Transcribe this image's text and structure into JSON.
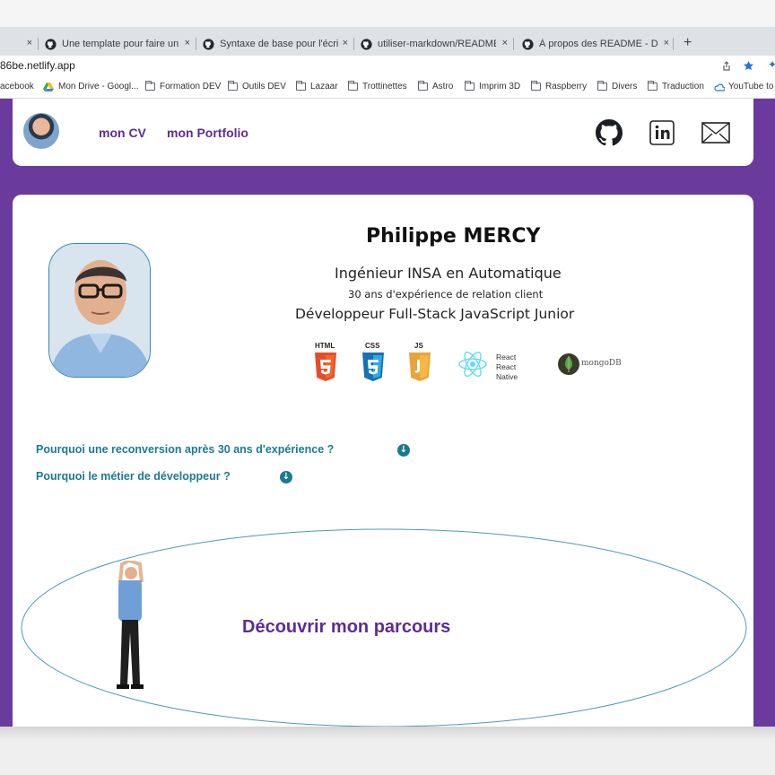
{
  "browser": {
    "tabs": [
      {
        "title": "",
        "close": "×"
      },
      {
        "title": "Une template pour faire un joli",
        "close": "×"
      },
      {
        "title": "Syntaxe de base pour l'écriture",
        "close": "×"
      },
      {
        "title": "utiliser-markdown/README.md",
        "close": "×"
      },
      {
        "title": "À propos des README - Docu",
        "close": "×"
      }
    ],
    "new_tab": "+",
    "url": "86be.netlify.app",
    "bookmarks": [
      "acebook",
      "Mon Drive - Googl...",
      "Formation DEV",
      "Outils DEV",
      "Lazaar",
      "Trottinettes",
      "Astro",
      "Imprim 3D",
      "Raspberry",
      "Divers",
      "Traduction",
      "YouTube to M"
    ]
  },
  "nav": {
    "cv_label": "mon CV",
    "portfolio_label": "mon Portfolio",
    "social_icons": [
      "github-icon",
      "linkedin-icon",
      "mail-icon"
    ]
  },
  "profile": {
    "name": "Philippe MERCY",
    "line1": "Ingénieur INSA en Automatique",
    "line2": "30 ans d'expérience de relation client",
    "line3": "Développeur Full-Stack JavaScript Junior"
  },
  "tech": {
    "html": "HTML",
    "css": "CSS",
    "js": "JS",
    "react": "React",
    "react_native": "React Native",
    "mongodb": "mongoDB"
  },
  "questions": [
    "Pourquoi une reconversion après 30 ans d'expérience ?",
    "Pourquoi le métier de développeur ?"
  ],
  "journey": {
    "title": "Découvrir mon parcours"
  },
  "colors": {
    "brand": "#5b2d96",
    "accent": "#1c7a8e",
    "frame": "#6a3a9c"
  }
}
